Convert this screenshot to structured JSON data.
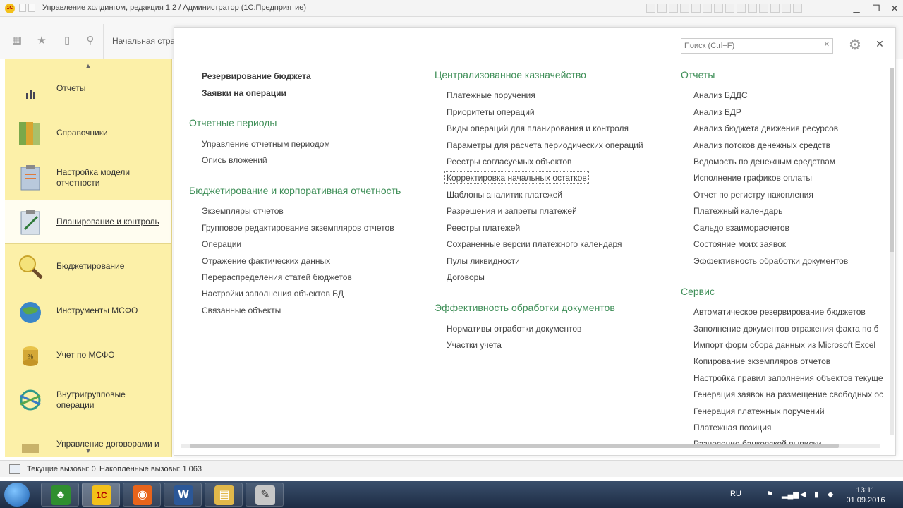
{
  "window": {
    "title": "Управление холдингом, редакция 1.2 / Администратор  (1С:Предприятие)",
    "logo": "1С"
  },
  "toolbar": {
    "home_tab": "Начальная стра"
  },
  "sidebar": {
    "items": [
      {
        "label": "Отчеты",
        "icon": "bar-chart-icon"
      },
      {
        "label": "Справочники",
        "icon": "books-icon"
      },
      {
        "label": "Настройка модели отчетности",
        "icon": "clipboard-icon"
      },
      {
        "label": "Планирование и контроль",
        "icon": "clipboard-pen-icon",
        "active": true
      },
      {
        "label": "Бюджетирование",
        "icon": "magnifier-icon"
      },
      {
        "label": "Инструменты МСФО",
        "icon": "globe-icon"
      },
      {
        "label": "Учет по МСФО",
        "icon": "coins-icon"
      },
      {
        "label": "Внутригрупповые операции",
        "icon": "exchange-icon"
      },
      {
        "label": "Управление договорами и",
        "icon": "contract-icon"
      }
    ]
  },
  "panel": {
    "search_placeholder": "Поиск (Ctrl+F)",
    "col1": {
      "top_links": [
        "Резервирование бюджета",
        "Заявки на операции"
      ],
      "groups": [
        {
          "title": "Отчетные периоды",
          "links": [
            "Управление отчетным периодом",
            "Опись вложений"
          ]
        },
        {
          "title": "Бюджетирование и корпоративная отчетность",
          "links": [
            "Экземпляры отчетов",
            "Групповое редактирование экземпляров отчетов",
            "Операции",
            "Отражение фактических данных",
            "Перераспределения статей бюджетов",
            "Настройки заполнения объектов БД",
            "Связанные объекты"
          ]
        }
      ]
    },
    "col2": {
      "groups": [
        {
          "title": "Централизованное казначейство",
          "links": [
            "Платежные поручения",
            "Приоритеты операций",
            "Виды операций для планирования и контроля",
            "Параметры для расчета периодических операций",
            "Реестры согласуемых объектов",
            "Корректировка начальных остатков",
            "Шаблоны аналитик платежей",
            "Разрешения и запреты платежей",
            "Реестры платежей",
            "Сохраненные версии платежного календаря",
            "Пулы ликвидности",
            "Договоры"
          ]
        },
        {
          "title": "Эффективность обработки документов",
          "links": [
            "Нормативы отработки документов",
            "Участки учета"
          ]
        }
      ]
    },
    "col3": {
      "groups": [
        {
          "title": "Отчеты",
          "links": [
            "Анализ БДДС",
            "Анализ БДР",
            "Анализ бюджета движения ресурсов",
            "Анализ потоков денежных средств",
            "Ведомость по денежным средствам",
            "Исполнение графиков оплаты",
            "Отчет по регистру накопления",
            "Платежный календарь",
            "Сальдо взаиморасчетов",
            "Состояние моих заявок",
            "Эффективность обработки документов"
          ]
        },
        {
          "title": "Сервис",
          "links": [
            "Автоматическое резервирование бюджетов",
            "Заполнение документов отражения факта по б",
            "Импорт форм сбора данных из Microsoft Excel",
            "Копирование экземпляров отчетов",
            "Настройка правил заполнения объектов текуще",
            "Генерация заявок на размещение свободных ос",
            "Генерация платежных поручений",
            "Платежная позиция",
            "Разнесение банковской выписки"
          ]
        }
      ]
    }
  },
  "statusbar": {
    "current_calls": "Текущие вызовы: 0",
    "accumulated_calls": "Накопленные вызовы: 1 063"
  },
  "taskbar": {
    "apps": [
      {
        "name": "tree-app",
        "glyph": "♣",
        "color": "#2f8f2f"
      },
      {
        "name": "1c-app",
        "glyph": "1С",
        "color": "#f3c11a",
        "active": true
      },
      {
        "name": "firefox-app",
        "glyph": "◉",
        "color": "#e8641b"
      },
      {
        "name": "word-app",
        "glyph": "W",
        "color": "#2b5797"
      },
      {
        "name": "explorer-app",
        "glyph": "▤",
        "color": "#e1b84a"
      },
      {
        "name": "paint-app",
        "glyph": "✎",
        "color": "#c7c7c7"
      }
    ],
    "lang": "RU",
    "time": "13:11",
    "date": "01.09.2016"
  }
}
